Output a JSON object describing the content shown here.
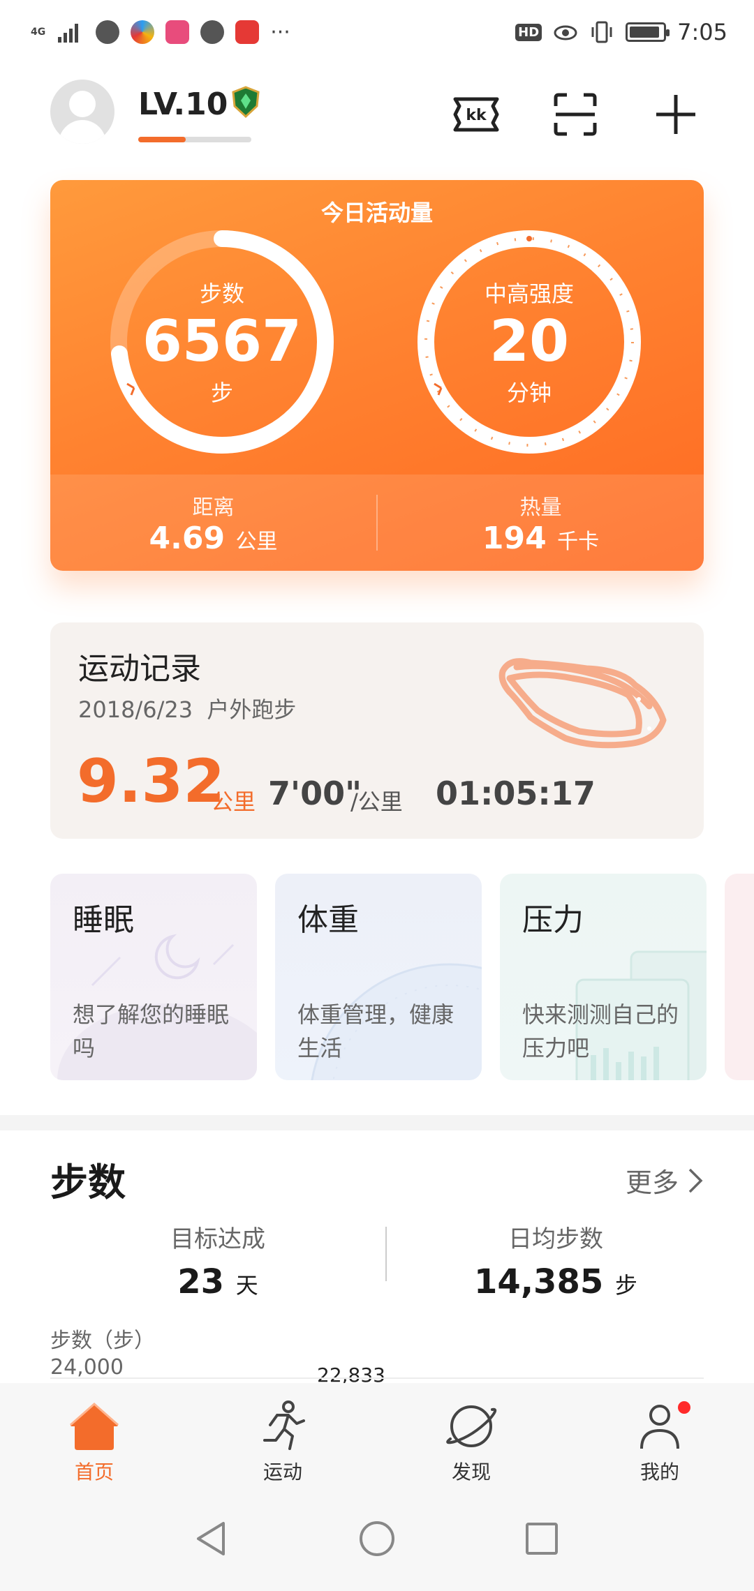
{
  "status_bar": {
    "network": "4G",
    "time": "7:05",
    "hd": "HD"
  },
  "header": {
    "level": "LV.10",
    "level_progress": 0.42
  },
  "activity": {
    "title": "今日活动量",
    "steps": {
      "label": "步数",
      "value": "6567",
      "unit": "步"
    },
    "intensity": {
      "label": "中高强度",
      "value": "20",
      "unit": "分钟"
    },
    "distance": {
      "label": "距离",
      "value": "4.69",
      "unit": "公里"
    },
    "calories": {
      "label": "热量",
      "value": "194",
      "unit": "千卡"
    }
  },
  "record": {
    "title": "运动记录",
    "date": "2018/6/23",
    "type": "户外跑步",
    "distance": "9.32",
    "distance_unit": "公里",
    "pace": "7'00\"",
    "pace_unit": "/公里",
    "duration": "01:05:17"
  },
  "cards": [
    {
      "title": "睡眠",
      "desc": "想了解您的睡眠吗"
    },
    {
      "title": "体重",
      "desc": "体重管理，健康生活"
    },
    {
      "title": "压力",
      "desc": "快来测测自己的压力吧"
    }
  ],
  "steps_section": {
    "title": "步数",
    "more": "更多",
    "goal_label": "目标达成",
    "goal_value": "23",
    "goal_unit": "天",
    "avg_label": "日均步数",
    "avg_value": "14,385",
    "avg_unit": "步",
    "chart_label": "步数（步）",
    "y_tick": "24,000",
    "peak_label": "22,833"
  },
  "nav": {
    "home": "首页",
    "sport": "运动",
    "discover": "发现",
    "me": "我的"
  },
  "colors": {
    "accent": "#f36c2b",
    "card_orange": "#ff8230"
  }
}
